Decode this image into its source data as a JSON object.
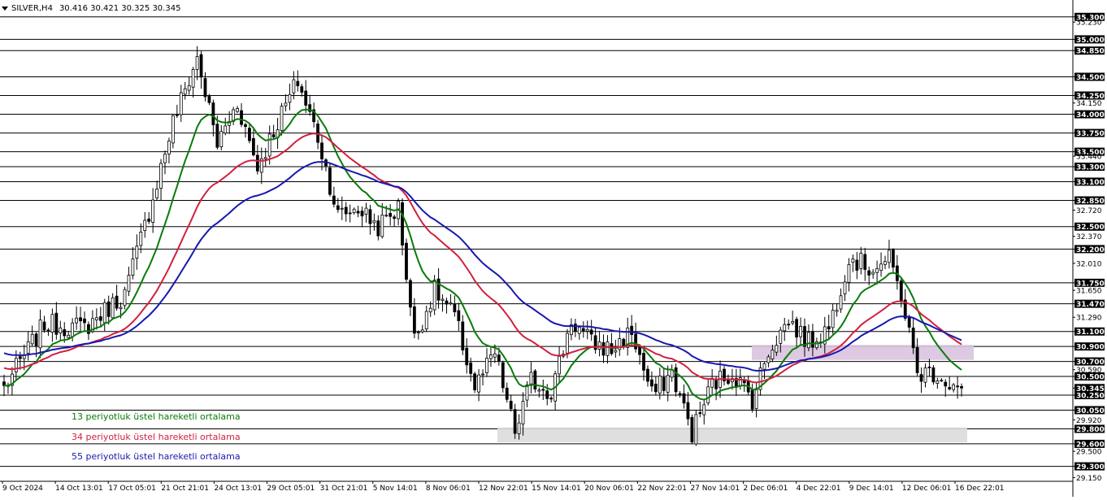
{
  "header": {
    "symbol": "SILVER,H4",
    "ohlc": "30.416 30.421 30.325 30.345"
  },
  "legend": {
    "ema13": "13 periyotluk üstel hareketli ortalama",
    "ema34": "34 periyotluk üstel hareketli ortalama",
    "ema55": "55 periyotluk üstel hareketli ortalama"
  },
  "colors": {
    "candles": "#000000",
    "ema13": "#0a7a0a",
    "ema34": "#d1203f",
    "ema55": "#1818b0",
    "resistance_zone": "#d9c3df",
    "support_zone": "#dcdcdc",
    "current_price_bg": "#000000"
  },
  "chart_data": {
    "type": "candlestick",
    "title": "SILVER,H4",
    "ylim": [
      29.1,
      35.33
    ],
    "price_ticks": [
      "35.300",
      "35.230",
      "35.000",
      "34.850",
      "34.500",
      "34.250",
      "34.150",
      "34.000",
      "33.750",
      "33.500",
      "33.440",
      "33.300",
      "33.100",
      "32.850",
      "32.720",
      "32.500",
      "32.370",
      "32.200",
      "32.010",
      "31.750",
      "31.650",
      "31.470",
      "31.290",
      "31.100",
      "30.900",
      "30.700",
      "30.590",
      "30.500",
      "30.345",
      "30.250",
      "30.050",
      "29.920",
      "29.800",
      "29.600",
      "29.500",
      "29.300",
      "29.150"
    ],
    "level_lines": [
      35.3,
      35.0,
      34.85,
      34.5,
      34.25,
      34.0,
      33.75,
      33.5,
      33.3,
      33.1,
      32.85,
      32.5,
      32.2,
      31.75,
      31.47,
      31.1,
      30.9,
      30.7,
      30.5,
      30.25,
      30.05,
      29.8,
      29.6,
      29.3
    ],
    "current_price": 30.345,
    "x_labels": [
      "9 Oct 2024",
      "14 Oct 13:01",
      "17 Oct 05:01",
      "21 Oct 21:01",
      "24 Oct 13:01",
      "29 Oct 05:01",
      "31 Oct 21:01",
      "5 Nov 14:01",
      "8 Nov 06:01",
      "12 Nov 22:01",
      "15 Nov 14:01",
      "20 Nov 06:01",
      "22 Nov 22:01",
      "27 Nov 14:01",
      "2 Dec 06:01",
      "4 Dec 22:01",
      "9 Dec 14:01",
      "12 Dec 06:01",
      "16 Dec 22:01"
    ],
    "zones": [
      {
        "name": "resistance",
        "from": 30.72,
        "to": 30.92
      },
      {
        "name": "support",
        "from": 29.62,
        "to": 29.82
      }
    ],
    "close_path_anchors": [
      [
        0,
        30.35
      ],
      [
        10,
        31.2
      ],
      [
        20,
        31.15
      ],
      [
        30,
        31.6
      ],
      [
        36,
        32.7
      ],
      [
        42,
        33.9
      ],
      [
        48,
        34.75
      ],
      [
        53,
        33.6
      ],
      [
        58,
        34.15
      ],
      [
        63,
        33.3
      ],
      [
        68,
        33.9
      ],
      [
        73,
        34.45
      ],
      [
        78,
        33.7
      ],
      [
        83,
        32.65
      ],
      [
        88,
        32.75
      ],
      [
        93,
        32.5
      ],
      [
        98,
        32.75
      ],
      [
        102,
        31.0
      ],
      [
        107,
        31.65
      ],
      [
        112,
        31.3
      ],
      [
        117,
        30.35
      ],
      [
        122,
        30.8
      ],
      [
        127,
        29.75
      ],
      [
        131,
        30.45
      ],
      [
        136,
        30.3
      ],
      [
        141,
        31.25
      ],
      [
        146,
        30.95
      ],
      [
        151,
        30.85
      ],
      [
        156,
        31.1
      ],
      [
        161,
        30.25
      ],
      [
        166,
        30.55
      ],
      [
        171,
        29.75
      ],
      [
        176,
        30.4
      ],
      [
        181,
        30.55
      ],
      [
        186,
        30.2
      ],
      [
        190,
        30.85
      ],
      [
        195,
        31.25
      ],
      [
        200,
        30.95
      ],
      [
        205,
        31.15
      ],
      [
        208,
        31.7
      ],
      [
        210,
        32.1
      ],
      [
        215,
        31.95
      ],
      [
        220,
        32.05
      ],
      [
        223,
        31.6
      ],
      [
        227,
        30.55
      ],
      [
        232,
        30.55
      ],
      [
        236,
        30.35
      ],
      [
        238,
        30.34
      ]
    ],
    "series": [
      {
        "name": "13 periyotluk üstel hareketli ortalama",
        "period": 13
      },
      {
        "name": "34 periyotluk üstel hareketli ortalama",
        "period": 34
      },
      {
        "name": "55 periyotluk üstel hareketli ortalama",
        "period": 55
      }
    ]
  }
}
